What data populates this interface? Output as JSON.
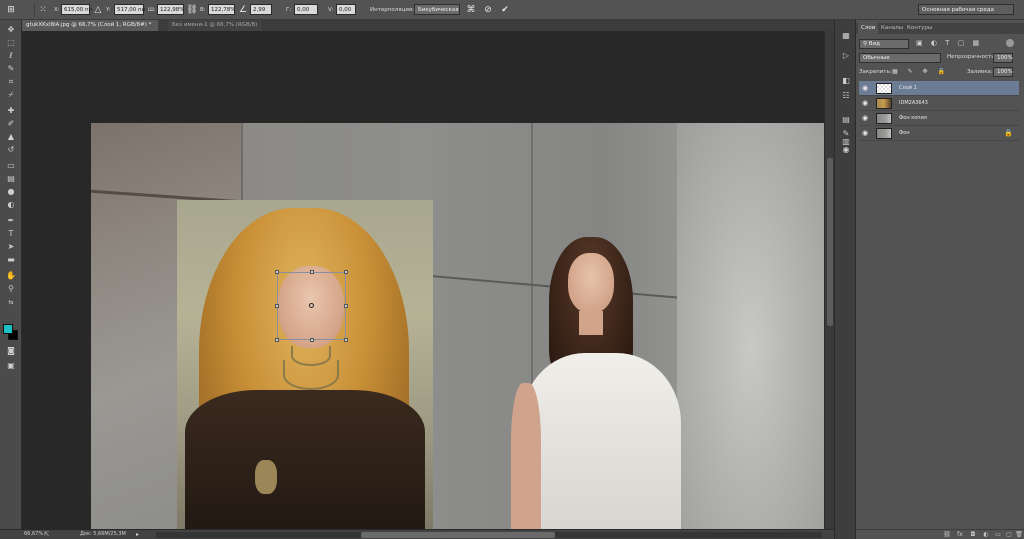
{
  "options_bar": {
    "x_label": "X:",
    "x_value": "615,00 пи",
    "y_label": "Y:",
    "y_value": "517,00 пи",
    "w_label": "Ш:",
    "w_value": "122,98%",
    "h_label": "В:",
    "h_value": "122,78%",
    "angle_value": "2,99",
    "hskew_label": "Г:",
    "hskew_value": "0,00",
    "vskew_label": "V:",
    "vskew_value": "0,00",
    "interp_label": "Интерполяция:",
    "interp_value": "Бикубическая",
    "workspace": "Основная рабочая среда"
  },
  "tabs": [
    {
      "label": "gtukXKxI8iA.jpg @ 66,7% (Слой 1, RGB/8#) *",
      "active": true
    },
    {
      "label": "Без имени-1 @ 66,7% (RGB/8)",
      "active": false
    }
  ],
  "status": {
    "zoom": "66,67%",
    "doc_info": "Док: 5,66M/25,3M"
  },
  "colors": {
    "foreground": "#1bc1c4",
    "background": "#000000",
    "accent": "#6d7c95"
  },
  "layers_panel": {
    "tabs": [
      "Слои",
      "Каналы",
      "Контуры"
    ],
    "filter_kind": "Вид",
    "blend_mode": "Обычные",
    "opacity_label": "Непрозрачность:",
    "opacity_value": "100%",
    "lock_label": "Закрепить:",
    "fill_label": "Заливка:",
    "fill_value": "100%",
    "layers": [
      {
        "name": "Слой 1",
        "selected": true
      },
      {
        "name": "IDM2A3643",
        "selected": false
      },
      {
        "name": "Фон копия",
        "selected": false
      },
      {
        "name": "Фон",
        "selected": false,
        "locked": true
      }
    ]
  },
  "icons": {
    "tools": [
      "move-icon",
      "marquee-icon",
      "lasso-icon",
      "quick-select-icon",
      "crop-icon",
      "eyedropper-icon",
      "healing-icon",
      "brush-icon",
      "stamp-icon",
      "history-brush-icon",
      "eraser-icon",
      "gradient-icon",
      "blur-icon",
      "dodge-icon",
      "pen-icon",
      "type-icon",
      "path-select-icon",
      "shape-icon",
      "hand-icon",
      "zoom-icon"
    ],
    "commit": "check-icon",
    "cancel": "cancel-icon"
  }
}
